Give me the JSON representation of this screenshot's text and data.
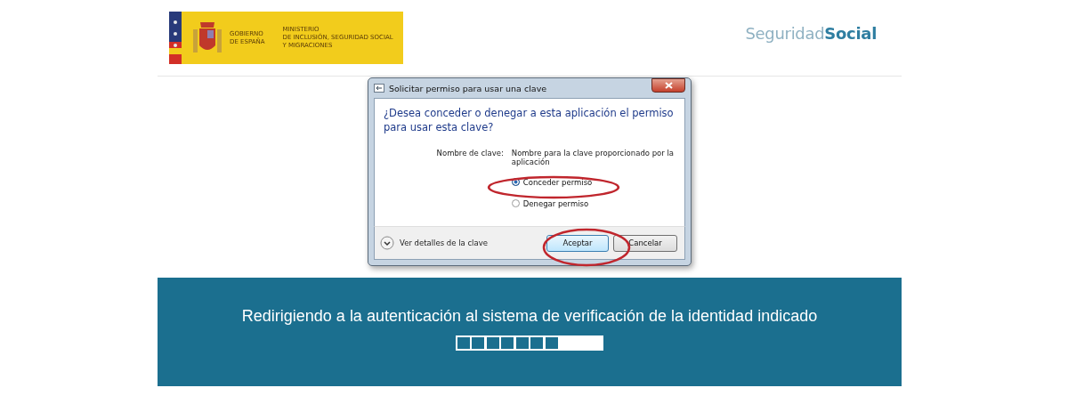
{
  "header": {
    "logo": {
      "government": [
        "GOBIERNO",
        "DE ESPAÑA"
      ],
      "ministry": [
        "MINISTERIO",
        "DE INCLUSIÓN, SEGURIDAD SOCIAL",
        "Y MIGRACIONES"
      ]
    },
    "brand": {
      "light": "Seguridad",
      "bold": "Social"
    }
  },
  "dialog": {
    "title": "Solicitar permiso para usar una clave",
    "question": "¿Desea conceder o denegar a esta aplicación el permiso para usar esta clave?",
    "key_name_label": "Nombre de clave:",
    "key_name_value": "Nombre para la clave proporcionado por la aplicación",
    "options": [
      {
        "label": "Conceder permiso",
        "selected": true
      },
      {
        "label": "Denegar permiso",
        "selected": false
      }
    ],
    "details_toggle": "Ver detalles de la clave",
    "buttons": [
      {
        "label": "Aceptar",
        "kind": "default"
      },
      {
        "label": "Cancelar",
        "kind": "normal"
      }
    ]
  },
  "banner": {
    "message": "Redirigiendo a la autenticación al sistema de verificación de la identidad indicado",
    "progress": {
      "level": 0.7
    }
  }
}
